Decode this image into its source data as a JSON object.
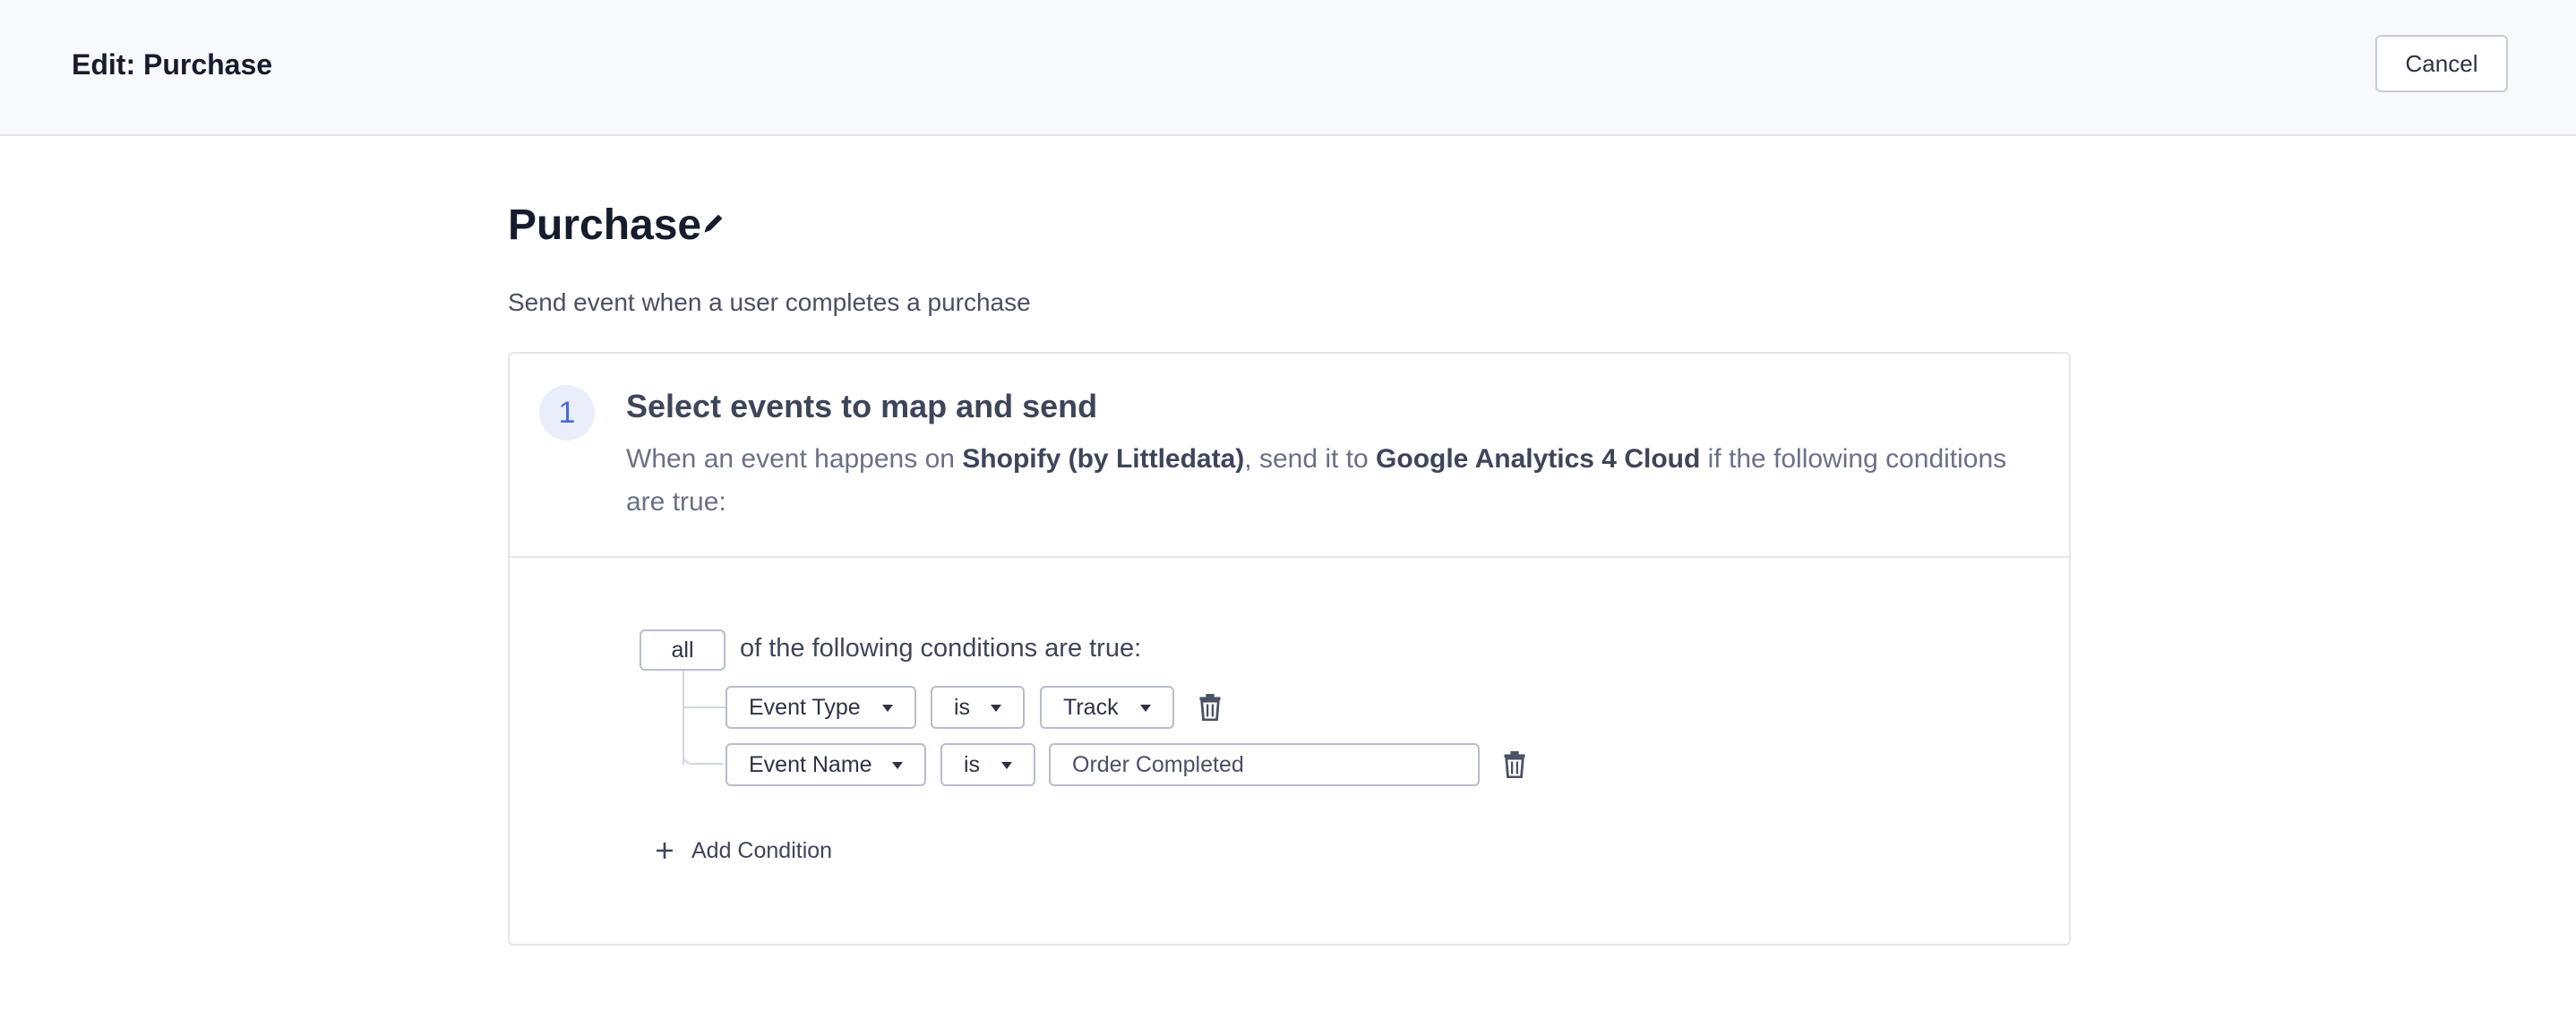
{
  "header": {
    "title": "Edit: Purchase",
    "cancel_label": "Cancel"
  },
  "page": {
    "title": "Purchase",
    "description": "Send event when a user completes a purchase"
  },
  "step": {
    "number": "1",
    "title": "Select events to map and send",
    "desc_prefix": "When an event happens on ",
    "source": "Shopify (by Littledata)",
    "desc_middle": ", send it to ",
    "destination": "Google Analytics 4 Cloud",
    "desc_suffix": " if the following conditions are true:"
  },
  "conditions": {
    "match_selector": "all",
    "match_text": "of the following conditions are true:",
    "rows": [
      {
        "field": "Event Type",
        "operator": "is",
        "value": "Track"
      },
      {
        "field": "Event Name",
        "operator": "is",
        "value": "Order Completed"
      }
    ],
    "add_label": "Add Condition"
  },
  "icons": {
    "edit": "pencil-icon",
    "delete": "trash-icon",
    "add": "plus-icon",
    "dropdown": "caret-down-icon"
  },
  "colors": {
    "accent": "#4a67d6",
    "header_bg": "#f8f9fc",
    "border": "#e3e6ee"
  }
}
